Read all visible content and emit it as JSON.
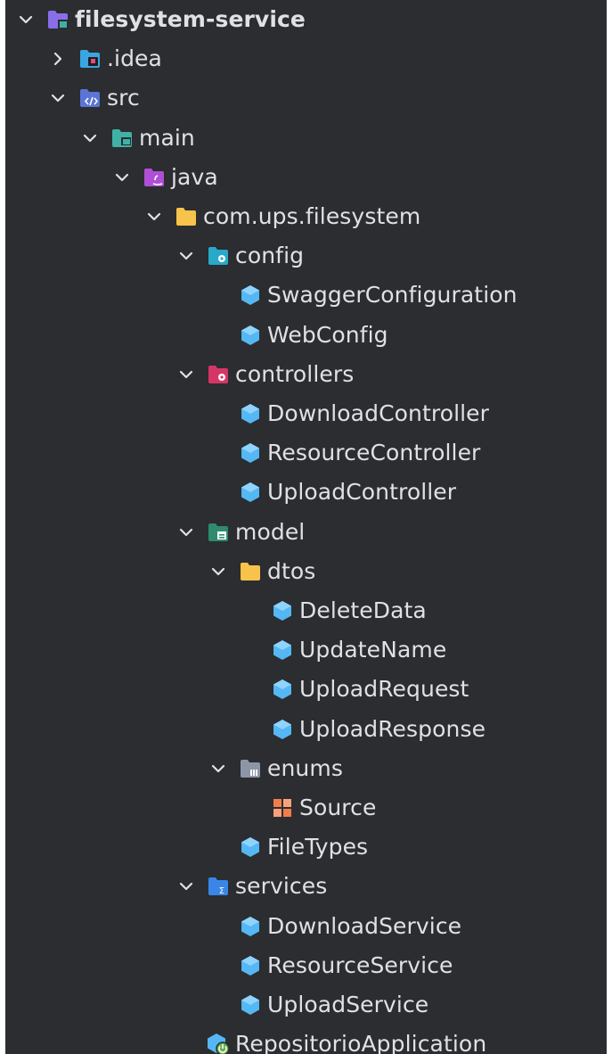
{
  "tree": [
    {
      "label": "filesystem-service",
      "depth": 0,
      "chevron": "down",
      "icon": "module-folder-icon",
      "bold": true
    },
    {
      "label": ".idea",
      "depth": 1,
      "chevron": "right",
      "icon": "idea-folder-icon"
    },
    {
      "label": "src",
      "depth": 1,
      "chevron": "down",
      "icon": "source-folder-icon"
    },
    {
      "label": "main",
      "depth": 2,
      "chevron": "down",
      "icon": "main-folder-icon"
    },
    {
      "label": "java",
      "depth": 3,
      "chevron": "down",
      "icon": "java-folder-icon"
    },
    {
      "label": "com.ups.filesystem",
      "depth": 4,
      "chevron": "down",
      "icon": "package-folder-icon"
    },
    {
      "label": "config",
      "depth": 5,
      "chevron": "down",
      "icon": "config-folder-icon"
    },
    {
      "label": "SwaggerConfiguration",
      "depth": 6,
      "chevron": "none",
      "icon": "class-icon"
    },
    {
      "label": "WebConfig",
      "depth": 6,
      "chevron": "none",
      "icon": "class-icon"
    },
    {
      "label": "controllers",
      "depth": 5,
      "chevron": "down",
      "icon": "controllers-folder-icon"
    },
    {
      "label": "DownloadController",
      "depth": 6,
      "chevron": "none",
      "icon": "class-icon"
    },
    {
      "label": "ResourceController",
      "depth": 6,
      "chevron": "none",
      "icon": "class-icon"
    },
    {
      "label": "UploadController",
      "depth": 6,
      "chevron": "none",
      "icon": "class-icon"
    },
    {
      "label": "model",
      "depth": 5,
      "chevron": "down",
      "icon": "model-folder-icon"
    },
    {
      "label": "dtos",
      "depth": 6,
      "chevron": "down",
      "icon": "folder-icon"
    },
    {
      "label": "DeleteData",
      "depth": 7,
      "chevron": "none",
      "icon": "class-icon"
    },
    {
      "label": "UpdateName",
      "depth": 7,
      "chevron": "none",
      "icon": "class-icon"
    },
    {
      "label": "UploadRequest",
      "depth": 7,
      "chevron": "none",
      "icon": "class-icon"
    },
    {
      "label": "UploadResponse",
      "depth": 7,
      "chevron": "none",
      "icon": "class-icon"
    },
    {
      "label": "enums",
      "depth": 6,
      "chevron": "down",
      "icon": "enums-folder-icon"
    },
    {
      "label": "Source",
      "depth": 7,
      "chevron": "none",
      "icon": "enum-icon"
    },
    {
      "label": "FileTypes",
      "depth": 6,
      "chevron": "none",
      "icon": "class-icon"
    },
    {
      "label": "services",
      "depth": 5,
      "chevron": "down",
      "icon": "services-folder-icon"
    },
    {
      "label": "DownloadService",
      "depth": 6,
      "chevron": "none",
      "icon": "class-icon"
    },
    {
      "label": "ResourceService",
      "depth": 6,
      "chevron": "none",
      "icon": "class-icon"
    },
    {
      "label": "UploadService",
      "depth": 6,
      "chevron": "none",
      "icon": "class-icon"
    },
    {
      "label": "RepositorioApplication",
      "depth": 5,
      "chevron": "none",
      "icon": "spring-boot-class-icon"
    }
  ],
  "colors": {
    "background": "#2b2d30",
    "text": "#dfe1e5",
    "chevron": "#dfe1e5",
    "class": "#55b7f4",
    "folder": "#f7c34a",
    "module": "#8a6ee8",
    "teal": "#3fb1a6",
    "controllers": "#d63567",
    "model": "#2f8a6e",
    "services": "#3a86e8",
    "enums": "#8c96a6",
    "enum": "#f37c4b"
  }
}
